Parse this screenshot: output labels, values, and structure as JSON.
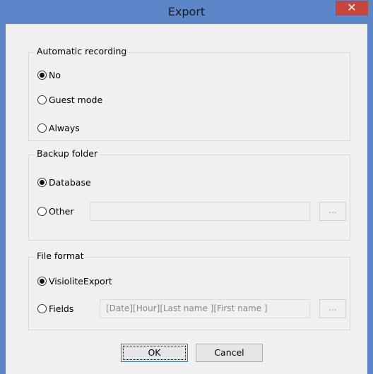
{
  "dialog": {
    "title": "Export",
    "close_symbol": "✕"
  },
  "automatic_recording": {
    "label": "Automatic recording",
    "options": [
      {
        "label": "No",
        "selected": true
      },
      {
        "label": "Guest mode",
        "selected": false
      },
      {
        "label": "Always",
        "selected": false
      }
    ]
  },
  "backup_folder": {
    "label": "Backup folder",
    "options": [
      {
        "label": "Database",
        "selected": true
      },
      {
        "label": "Other",
        "selected": false
      }
    ],
    "other_path_value": "",
    "browse_label": "..."
  },
  "file_format": {
    "label": "File format",
    "options": [
      {
        "label": "VisioliteExport",
        "selected": true
      },
      {
        "label": "Fields",
        "selected": false
      }
    ],
    "fields_value": "[Date][Hour][Last name ][First name ]",
    "browse_label": "..."
  },
  "buttons": {
    "ok": "OK",
    "cancel": "Cancel"
  },
  "colors": {
    "title_bar": "#5b86c8",
    "close_button": "#c7453a",
    "client_bg": "#f0f0f0"
  }
}
